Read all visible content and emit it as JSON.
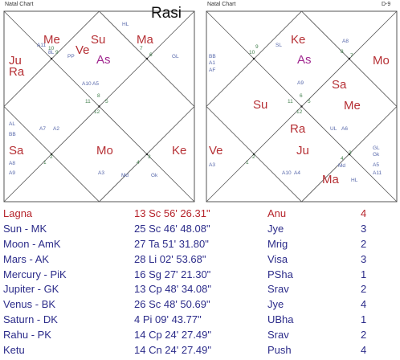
{
  "charts": {
    "rasi": {
      "panel_title": "Natal Chart",
      "heading": "Rasi",
      "big_labels": [
        {
          "text": "Me",
          "color": "#b63035"
        },
        {
          "text": "Ve",
          "color": "#b63035"
        },
        {
          "text": "Su",
          "color": "#b63035"
        },
        {
          "text": "Ma",
          "color": "#b63035"
        },
        {
          "text": "As",
          "color": "#a0278f"
        },
        {
          "text": "Ju",
          "color": "#b63035"
        },
        {
          "text": "Ra",
          "color": "#b63035"
        },
        {
          "text": "Sa",
          "color": "#b63035"
        },
        {
          "text": "Mo",
          "color": "#b63035"
        },
        {
          "text": "Ke",
          "color": "#b63035"
        }
      ],
      "small_labels": [
        "A11",
        "8L",
        "PP",
        "HL",
        "GL",
        "A10",
        "A5",
        "AL",
        "A7",
        "A2",
        "BB",
        "A8",
        "A9",
        "A3",
        "Md",
        "Gk"
      ],
      "house_numbers": [
        "10",
        "9",
        "7",
        "6",
        "8",
        "11",
        "5",
        "12",
        "4",
        "1",
        "3",
        "2"
      ]
    },
    "d9": {
      "panel_title": "Natal Chart",
      "heading": "D-9",
      "big_labels": [
        {
          "text": "Ke",
          "color": "#b63035"
        },
        {
          "text": "As",
          "color": "#a0278f"
        },
        {
          "text": "Mo",
          "color": "#b63035"
        },
        {
          "text": "Su",
          "color": "#b63035"
        },
        {
          "text": "Sa",
          "color": "#b63035"
        },
        {
          "text": "Me",
          "color": "#b63035"
        },
        {
          "text": "Ra",
          "color": "#b63035"
        },
        {
          "text": "Ju",
          "color": "#b63035"
        },
        {
          "text": "Ma",
          "color": "#b63035"
        },
        {
          "text": "Ve",
          "color": "#b63035"
        }
      ],
      "small_labels": [
        "SL",
        "BB",
        "A1",
        "AF",
        "A9",
        "UL",
        "A6",
        "HL",
        "A10",
        "A4",
        "Md",
        "A5",
        "A11",
        "Gk",
        "GL",
        "A3",
        "A8"
      ],
      "house_numbers": [
        "10",
        "9",
        "8",
        "7",
        "6",
        "11",
        "5",
        "12",
        "4",
        "1",
        "3",
        "2"
      ]
    }
  },
  "positions": [
    {
      "planet": "Lagna",
      "longitude": "13 Sc 56' 26.31\"",
      "nakshatra": "Anu",
      "pada": "4"
    },
    {
      "planet": "Sun - MK",
      "longitude": "25 Sc 46' 48.08\"",
      "nakshatra": "Jye",
      "pada": "3"
    },
    {
      "planet": "Moon - AmK",
      "longitude": "27 Ta 51' 31.80\"",
      "nakshatra": "Mrig",
      "pada": "2"
    },
    {
      "planet": "Mars - AK",
      "longitude": "28 Li 02' 53.68\"",
      "nakshatra": "Visa",
      "pada": "3"
    },
    {
      "planet": "Mercury - PiK",
      "longitude": "16 Sg 27' 21.30\"",
      "nakshatra": "PSha",
      "pada": "1"
    },
    {
      "planet": "Jupiter - GK",
      "longitude": "13 Cp 48' 34.08\"",
      "nakshatra": "Srav",
      "pada": "2"
    },
    {
      "planet": "Venus - BK",
      "longitude": "26 Sc 48' 50.69\"",
      "nakshatra": "Jye",
      "pada": "4"
    },
    {
      "planet": "Saturn - DK",
      "longitude": "4 Pi 09' 43.77\"",
      "nakshatra": "UBha",
      "pada": "1"
    },
    {
      "planet": "Rahu - PK",
      "longitude": "14 Cp 24' 27.49\"",
      "nakshatra": "Srav",
      "pada": "2"
    },
    {
      "planet": "Ketu",
      "longitude": "14 Cn 24' 27.49\"",
      "nakshatra": "Push",
      "pada": "4"
    }
  ],
  "colors": {
    "planet_text": "#b63035",
    "ascendant_text": "#a0278f",
    "small_text": "#5566aa",
    "house_number": "#3f7d4a",
    "table_text": "#2c2c8a",
    "table_first_row": "#b6242b"
  }
}
